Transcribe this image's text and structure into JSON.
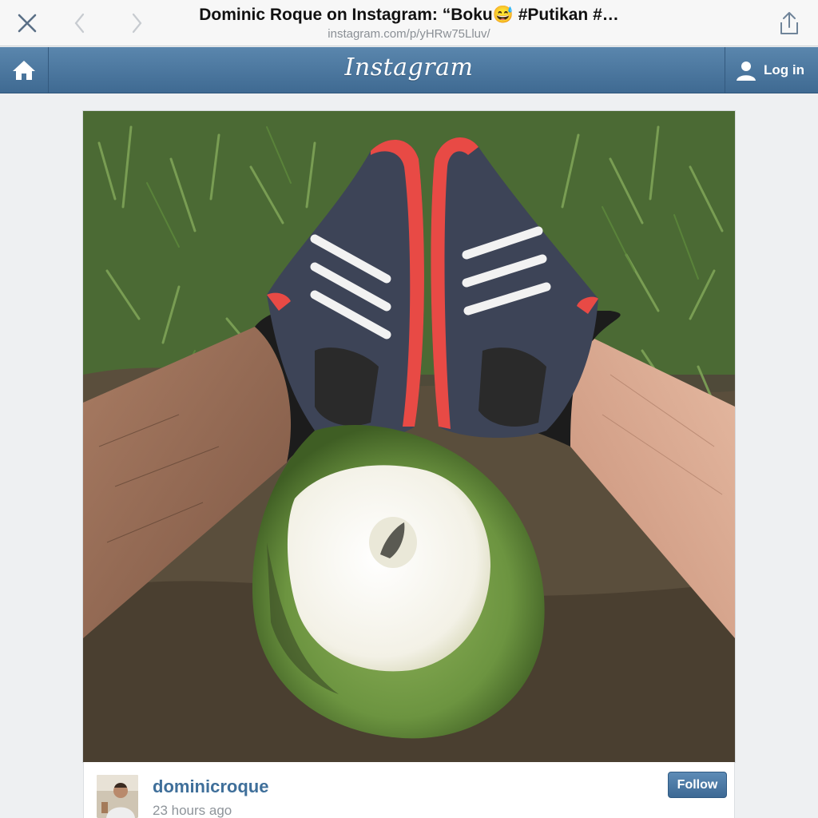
{
  "browser": {
    "title": "Dominic Roque on Instagram: “Boku😅 #Putikan #…",
    "url": "instagram.com/p/yHRw75Lluv/"
  },
  "header": {
    "logo": "Instagram",
    "login_label": "Log in"
  },
  "post": {
    "username": "dominicroque",
    "time_ago": "23 hours ago",
    "follow_label": "Follow"
  },
  "icons": {
    "close": "close-icon",
    "back": "chevron-left-icon",
    "forward": "chevron-right-icon",
    "share": "share-icon",
    "home": "home-icon",
    "user": "user-icon"
  },
  "colors": {
    "header_blue": "#4a76a0",
    "link_blue": "#3f6f9a",
    "follow_blue": "#4a78a4"
  }
}
